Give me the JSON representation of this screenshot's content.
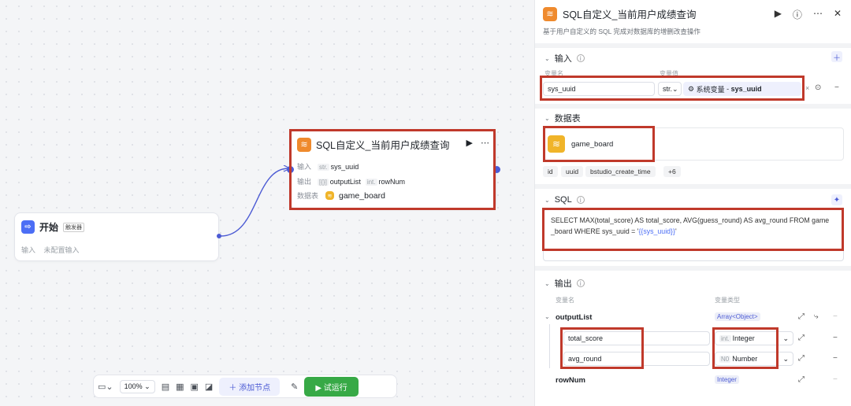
{
  "canvas": {
    "start_node": {
      "title": "开始",
      "badge": "触发器",
      "input_label": "输入",
      "input_value": "未配置输入"
    },
    "sql_node": {
      "title": "SQL自定义_当前用户成绩查询",
      "input_label": "输入",
      "input_type": "str.",
      "input_value": "sys_uuid",
      "output_label": "输出",
      "output_type1": "[{}]",
      "output_value1": "outputList",
      "output_type2": "int.",
      "output_value2": "rowNum",
      "table_label": "数据表",
      "table_value": "game_board"
    },
    "toolbar": {
      "zoom": "100%",
      "add_node": "添加节点",
      "run": "试运行"
    }
  },
  "panel": {
    "title": "SQL自定义_当前用户成绩查询",
    "description": "基于用户自定义的 SQL 完成对数据库的增删改查操作",
    "input": {
      "heading": "输入",
      "col_name": "变量名",
      "col_value": "变量值",
      "var_name": "sys_uuid",
      "type": "str.",
      "value_source": "系统变量",
      "value_var": "sys_uuid"
    },
    "table": {
      "heading": "数据表",
      "name": "game_board",
      "fields": [
        "id",
        "uuid",
        "bstudio_create_time",
        "+6"
      ]
    },
    "sql": {
      "heading": "SQL",
      "line1": "SELECT MAX(total_score) AS total_score, AVG(guess_round) AS avg_round FROM game",
      "line2_prefix": "_board WHERE sys_uuid = '",
      "line2_var": "{{sys_uuid}}",
      "line2_suffix": "'"
    },
    "output": {
      "heading": "输出",
      "col_name": "变量名",
      "col_type": "变量类型",
      "root_name": "outputList",
      "root_type": "Array<Object>",
      "children": [
        {
          "name": "total_score",
          "type_icon": "int.",
          "type": "Integer"
        },
        {
          "name": "avg_round",
          "type_icon": "N0",
          "type": "Number"
        }
      ],
      "rownum_name": "rowNum",
      "rownum_type": "Integer"
    }
  }
}
